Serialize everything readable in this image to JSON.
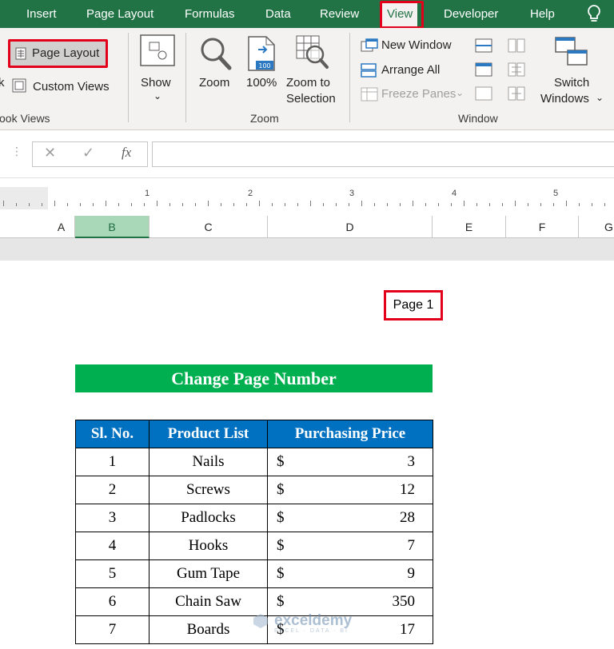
{
  "tabs": [
    {
      "label": "Insert",
      "active": false
    },
    {
      "label": "Page Layout",
      "active": false
    },
    {
      "label": "Formulas",
      "active": false
    },
    {
      "label": "Data",
      "active": false
    },
    {
      "label": "Review",
      "active": false
    },
    {
      "label": "View",
      "active": true
    },
    {
      "label": "Developer",
      "active": false
    },
    {
      "label": "Help",
      "active": false
    }
  ],
  "ribbon": {
    "workbook_views": {
      "partial_text": "k",
      "page_layout": "Page Layout",
      "custom_views": "Custom Views",
      "group_label": "ook Views"
    },
    "show": {
      "label": "Show"
    },
    "zoom": {
      "zoom": "Zoom",
      "hundred": "100%",
      "zoom_to_line1": "Zoom to",
      "zoom_to_line2": "Selection",
      "group_label": "Zoom"
    },
    "window": {
      "new_window": "New Window",
      "arrange_all": "Arrange All",
      "freeze_panes": "Freeze Panes",
      "switch_line1": "Switch",
      "switch_line2": "Windows",
      "group_label": "Window"
    }
  },
  "formula_bar": {
    "fx": "fx",
    "value": ""
  },
  "ruler": {
    "numbers": [
      "1",
      "2",
      "3",
      "4",
      "5"
    ]
  },
  "columns": [
    "A",
    "B",
    "C",
    "D",
    "E",
    "F",
    "G"
  ],
  "selected_column": "B",
  "page_label": "Page 1",
  "banner_title": "Change Page Number",
  "table": {
    "headers": [
      "Sl. No.",
      "Product List",
      "Purchasing Price"
    ],
    "currency": "$",
    "rows": [
      {
        "sl": "1",
        "product": "Nails",
        "price": "3"
      },
      {
        "sl": "2",
        "product": "Screws",
        "price": "12"
      },
      {
        "sl": "3",
        "product": "Padlocks",
        "price": "28"
      },
      {
        "sl": "4",
        "product": "Hooks",
        "price": "7"
      },
      {
        "sl": "5",
        "product": "Gum Tape",
        "price": "9"
      },
      {
        "sl": "6",
        "product": "Chain Saw",
        "price": "350"
      },
      {
        "sl": "7",
        "product": "Boards",
        "price": "17"
      }
    ]
  },
  "watermark": {
    "name": "exceldemy",
    "tagline": "EXCEL · DATA · BI"
  },
  "colors": {
    "excel_green": "#217346",
    "highlight_red": "#e3001b",
    "banner_green": "#00b050",
    "header_blue": "#0070c0"
  }
}
